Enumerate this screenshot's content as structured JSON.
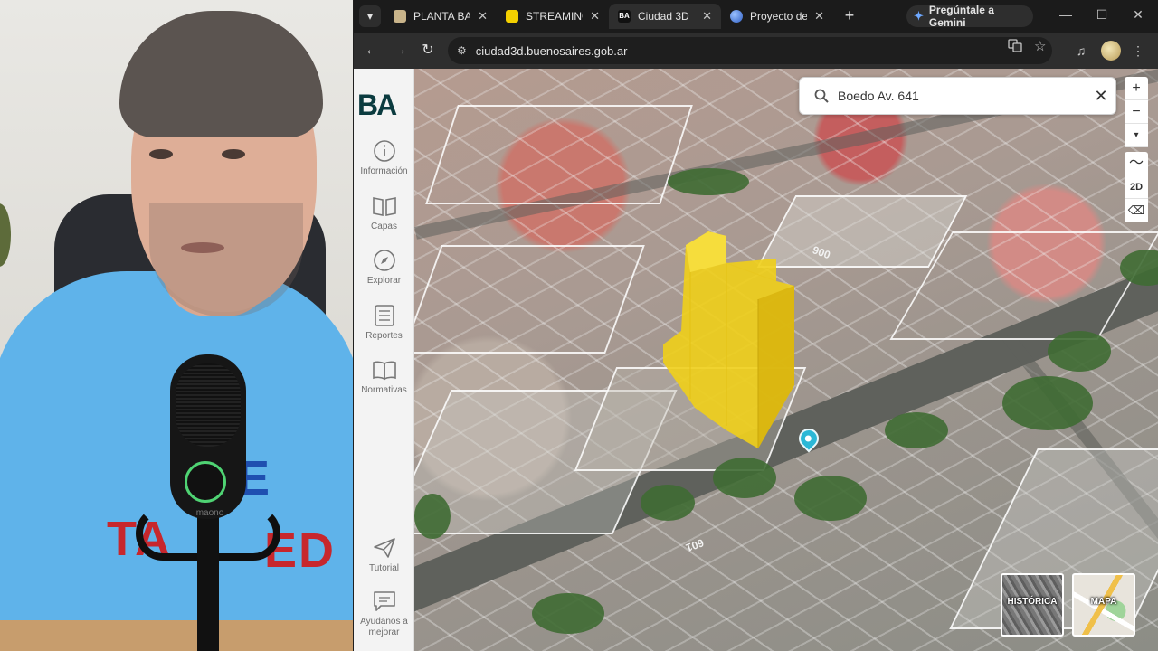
{
  "browser": {
    "tabs": [
      {
        "title": "PLANTA BAJA",
        "active": false,
        "icon": "doc-icon",
        "color": "#c9b48a"
      },
      {
        "title": "STREAMING",
        "active": false,
        "icon": "streaming-icon",
        "color": "#f4d000"
      },
      {
        "title": "Ciudad 3D",
        "active": true,
        "icon": "ba-icon",
        "color": "#111111"
      },
      {
        "title": "Proyecto de",
        "active": false,
        "icon": "globe-icon",
        "color": "#4a7be0"
      }
    ],
    "new_tab": "+",
    "gemini_label": "Pregúntale a Gemini",
    "address": "ciudad3d.buenosaires.gob.ar",
    "window_controls": [
      "minimize-icon",
      "maximize-icon",
      "close-icon"
    ]
  },
  "sidebar": {
    "logo": "BA",
    "items": [
      {
        "label": "Información",
        "icon": "info-icon"
      },
      {
        "label": "Capas",
        "icon": "book-icon"
      },
      {
        "label": "Explorar",
        "icon": "compass-icon"
      },
      {
        "label": "Reportes",
        "icon": "list-icon"
      },
      {
        "label": "Normativas",
        "icon": "open-book-icon"
      }
    ],
    "bottom_items": [
      {
        "label": "Tutorial",
        "icon": "send-icon"
      },
      {
        "label": "Ayudanos a mejorar",
        "icon": "feedback-icon"
      }
    ]
  },
  "search": {
    "value": "Boedo Av. 641"
  },
  "map": {
    "controls": [
      "+",
      "−",
      "▾",
      "〜",
      "2D",
      "⌫"
    ],
    "street_labels": [
      "601",
      "006"
    ],
    "basemaps": [
      {
        "label": "HISTÓRICA",
        "icon": "satellite-thumbnail"
      },
      {
        "label": "MAPA",
        "icon": "map-thumbnail"
      }
    ],
    "highlight_color": "#f0cf1a"
  },
  "webcam": {
    "shirt_text": [
      "E",
      "TA",
      "ED"
    ],
    "mic_brand": "maono"
  }
}
